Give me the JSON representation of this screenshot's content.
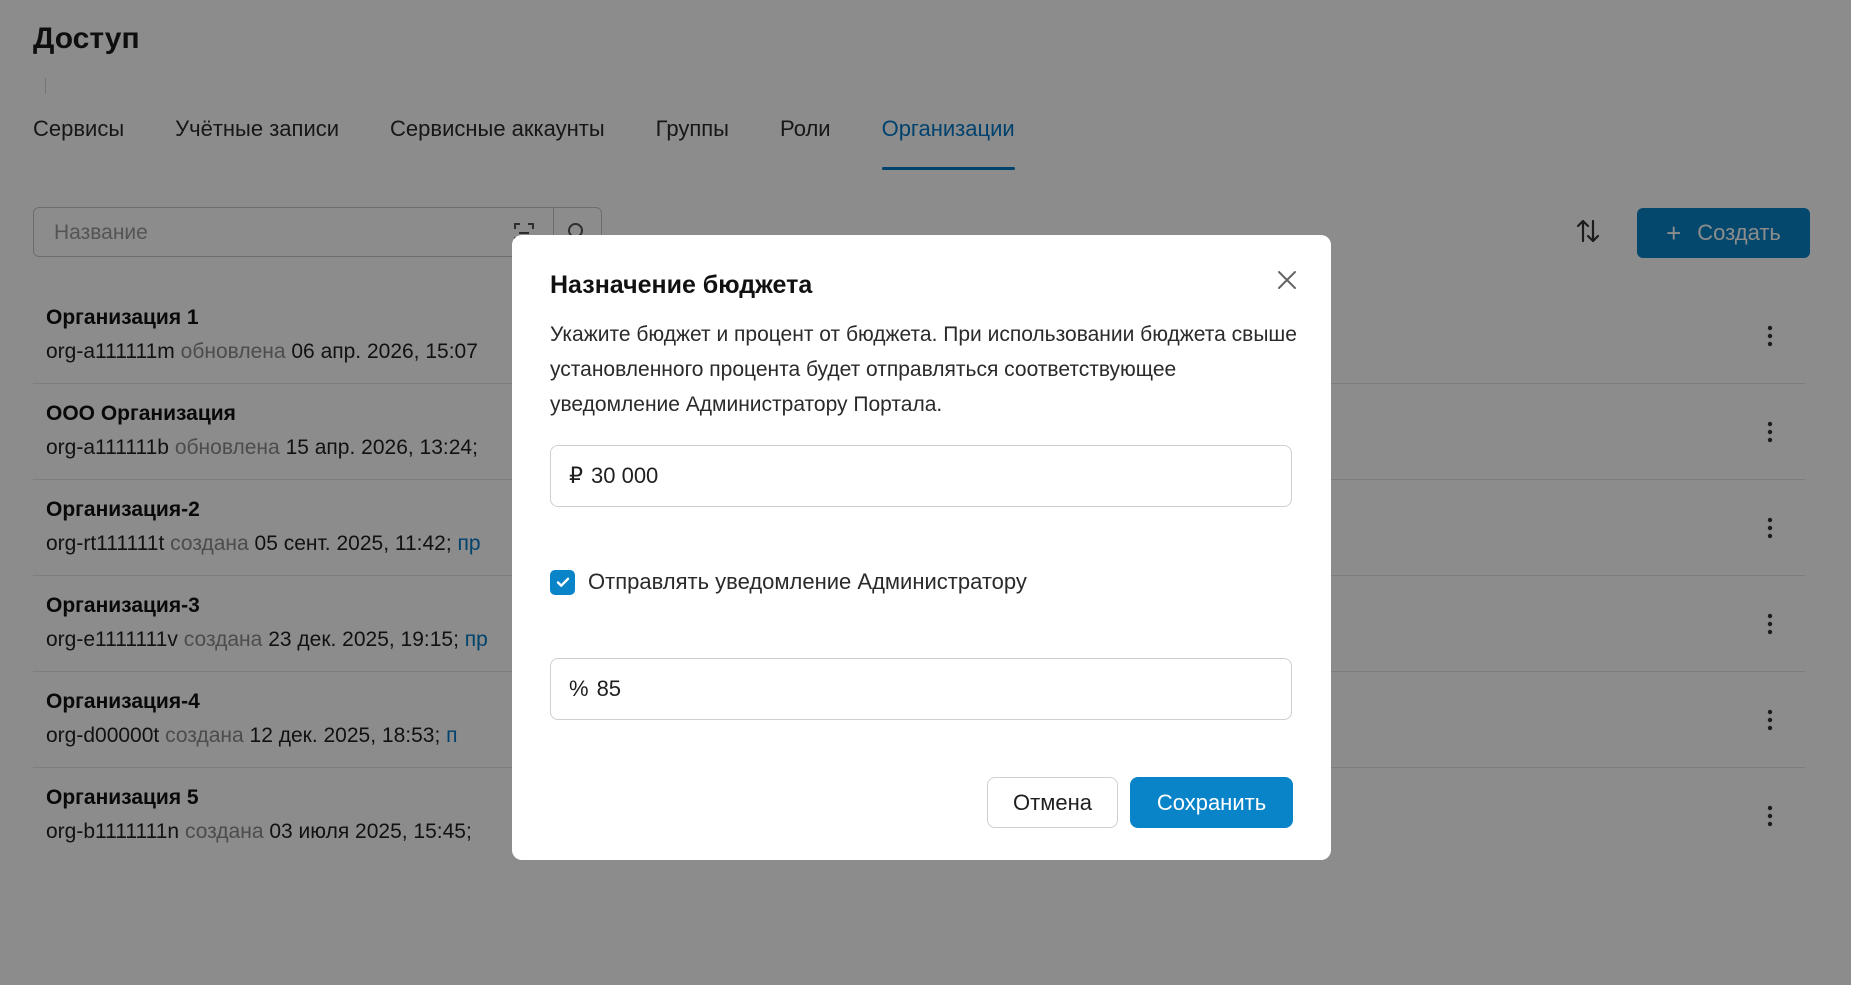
{
  "page": {
    "title": "Доступ",
    "tabs": [
      {
        "label": "Сервисы"
      },
      {
        "label": "Учётные записи"
      },
      {
        "label": "Сервисные аккаунты"
      },
      {
        "label": "Группы"
      },
      {
        "label": "Роли"
      },
      {
        "label": "Организации",
        "active": true
      }
    ],
    "search": {
      "placeholder": "Название"
    },
    "create_label": "Создать",
    "organizations": [
      {
        "name": "Организация 1",
        "id": "org-a111111m",
        "status": "обновлена",
        "date": "06 апр. 2026, 15:07",
        "sep": "",
        "link": ""
      },
      {
        "name": "ООО Организация",
        "id": "org-a111111b",
        "status": "обновлена",
        "date": "15 апр. 2026, 13:24",
        "sep": ";",
        "link": ""
      },
      {
        "name": "Организация-2",
        "id": "org-rt111111t",
        "status": "создана",
        "date": "05 сент. 2025, 11:42",
        "sep": ";",
        "link": "пр"
      },
      {
        "name": "Организация-3",
        "id": "org-e1111111v",
        "status": "создана",
        "date": "23 дек. 2025, 19:15",
        "sep": ";",
        "link": "пр"
      },
      {
        "name": "Организация-4",
        "id": "org-d00000t",
        "status": "создана",
        "date": "12 дек. 2025, 18:53",
        "sep": ";",
        "link": "п"
      },
      {
        "name": "Организация 5",
        "id": "org-b1111111n",
        "status": "создана",
        "date": "03 июля 2025, 15:45",
        "sep": ";",
        "link": ""
      }
    ]
  },
  "modal": {
    "title": "Назначение бюджета",
    "description": "Укажите бюджет и процент от бюджета. При использовании бюджета свыше установленного процента будет отправляться соответствующее уведомление Администратору Портала.",
    "budget": {
      "prefix": "₽",
      "value": "30 000"
    },
    "notify": {
      "label": "Отправлять уведомление Администратору",
      "checked": true
    },
    "percent": {
      "prefix": "%",
      "value": "85"
    },
    "cancel_label": "Отмена",
    "save_label": "Сохранить"
  },
  "colors": {
    "accent": "#0a84c8",
    "link": "#0078c8",
    "overlay": "rgba(0,0,0,0.45)"
  }
}
